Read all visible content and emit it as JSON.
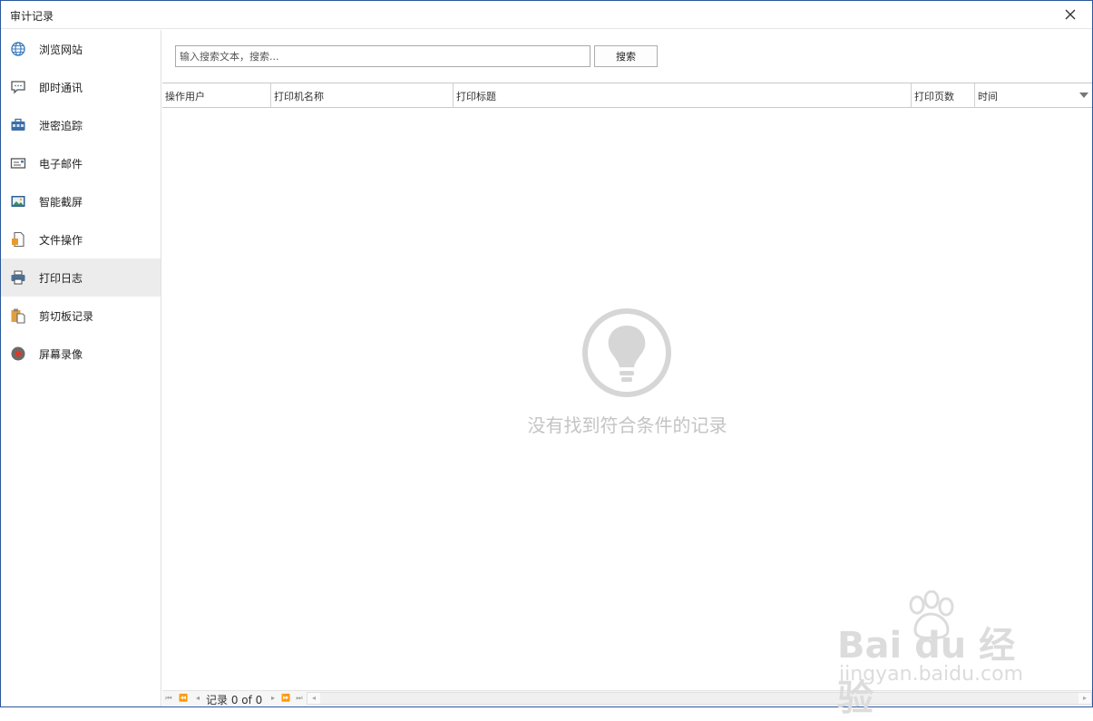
{
  "window": {
    "title": "审计记录"
  },
  "sidebar": {
    "items": [
      {
        "label": "浏览网站",
        "icon": "globe-icon"
      },
      {
        "label": "即时通讯",
        "icon": "chat-icon"
      },
      {
        "label": "泄密追踪",
        "icon": "briefcase-icon"
      },
      {
        "label": "电子邮件",
        "icon": "email-icon"
      },
      {
        "label": "智能截屏",
        "icon": "screenshot-icon"
      },
      {
        "label": "文件操作",
        "icon": "file-icon"
      },
      {
        "label": "打印日志",
        "icon": "printer-icon",
        "active": true
      },
      {
        "label": "剪切板记录",
        "icon": "clipboard-icon"
      },
      {
        "label": "屏幕录像",
        "icon": "record-icon"
      }
    ]
  },
  "search": {
    "placeholder": "输入搜索文本，搜索...",
    "value": "",
    "button_label": "搜索"
  },
  "table": {
    "columns": [
      "操作用户",
      "打印机名称",
      "打印标题",
      "打印页数",
      "时间"
    ],
    "rows": []
  },
  "empty_state": {
    "message": "没有找到符合条件的记录"
  },
  "pager": {
    "prefix": "记录",
    "text": "0 of 0"
  },
  "watermark": {
    "brand": "Bai du 经验",
    "url": "jingyan.baidu.com"
  },
  "colors": {
    "active_bg": "#ececec",
    "accent": "#2b579a",
    "empty_icon": "#d6d6d6"
  }
}
